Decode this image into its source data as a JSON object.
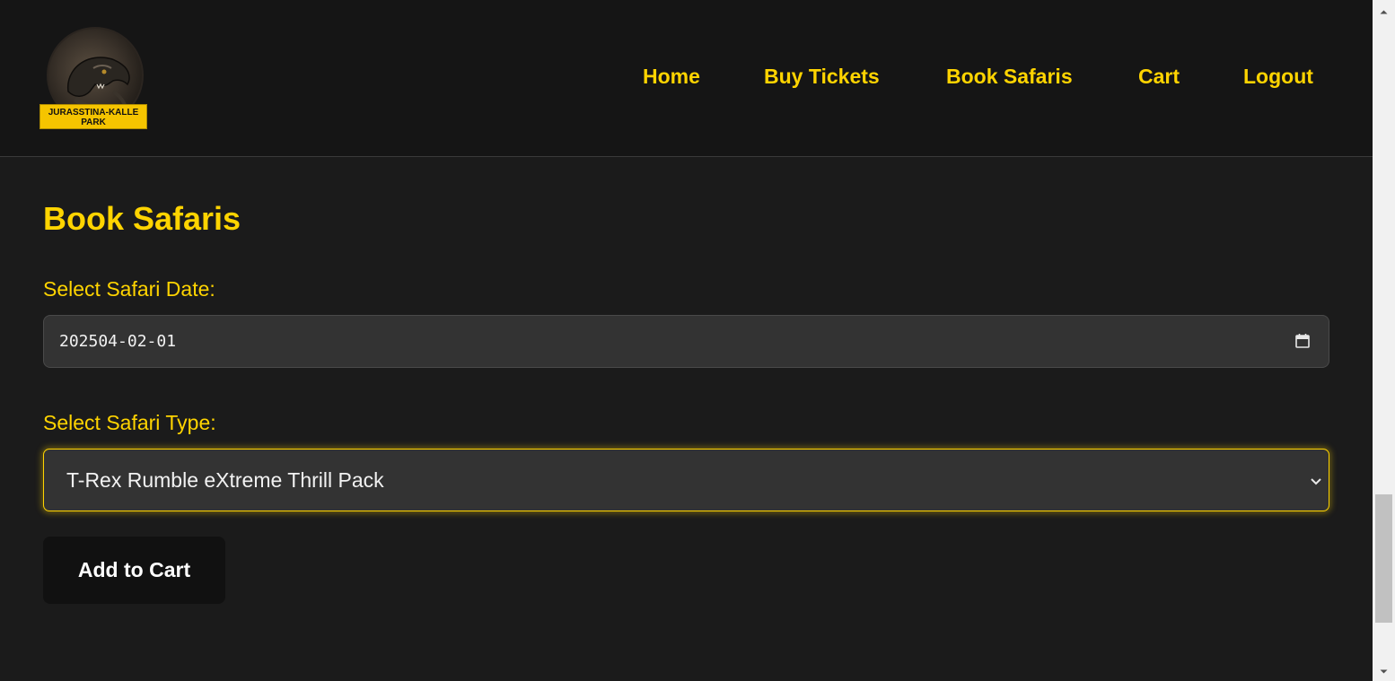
{
  "header": {
    "logo": {
      "text": "JURASSTINA-KALLE PARK",
      "line1": "JURASSTINA-KALLE",
      "line2": "PARK"
    },
    "nav": [
      {
        "label": "Home"
      },
      {
        "label": "Buy Tickets"
      },
      {
        "label": "Book Safaris"
      },
      {
        "label": "Cart"
      },
      {
        "label": "Logout"
      }
    ]
  },
  "main": {
    "title": "Book Safaris",
    "date_label": "Select Safari Date:",
    "date_value": "202504-02-01",
    "type_label": "Select Safari Type:",
    "type_value": "T-Rex Rumble eXtreme Thrill Pack",
    "add_button": "Add to Cart"
  },
  "colors": {
    "accent": "#ffd400",
    "background": "#1b1b1b",
    "header_bg": "#151515",
    "input_bg": "#333333",
    "button_bg": "#111111"
  },
  "icons": {
    "date_picker": "calendar-icon",
    "select": "chevron-down-icon",
    "scroll_up": "scroll-up-arrow",
    "scroll_down": "scroll-down-arrow"
  }
}
